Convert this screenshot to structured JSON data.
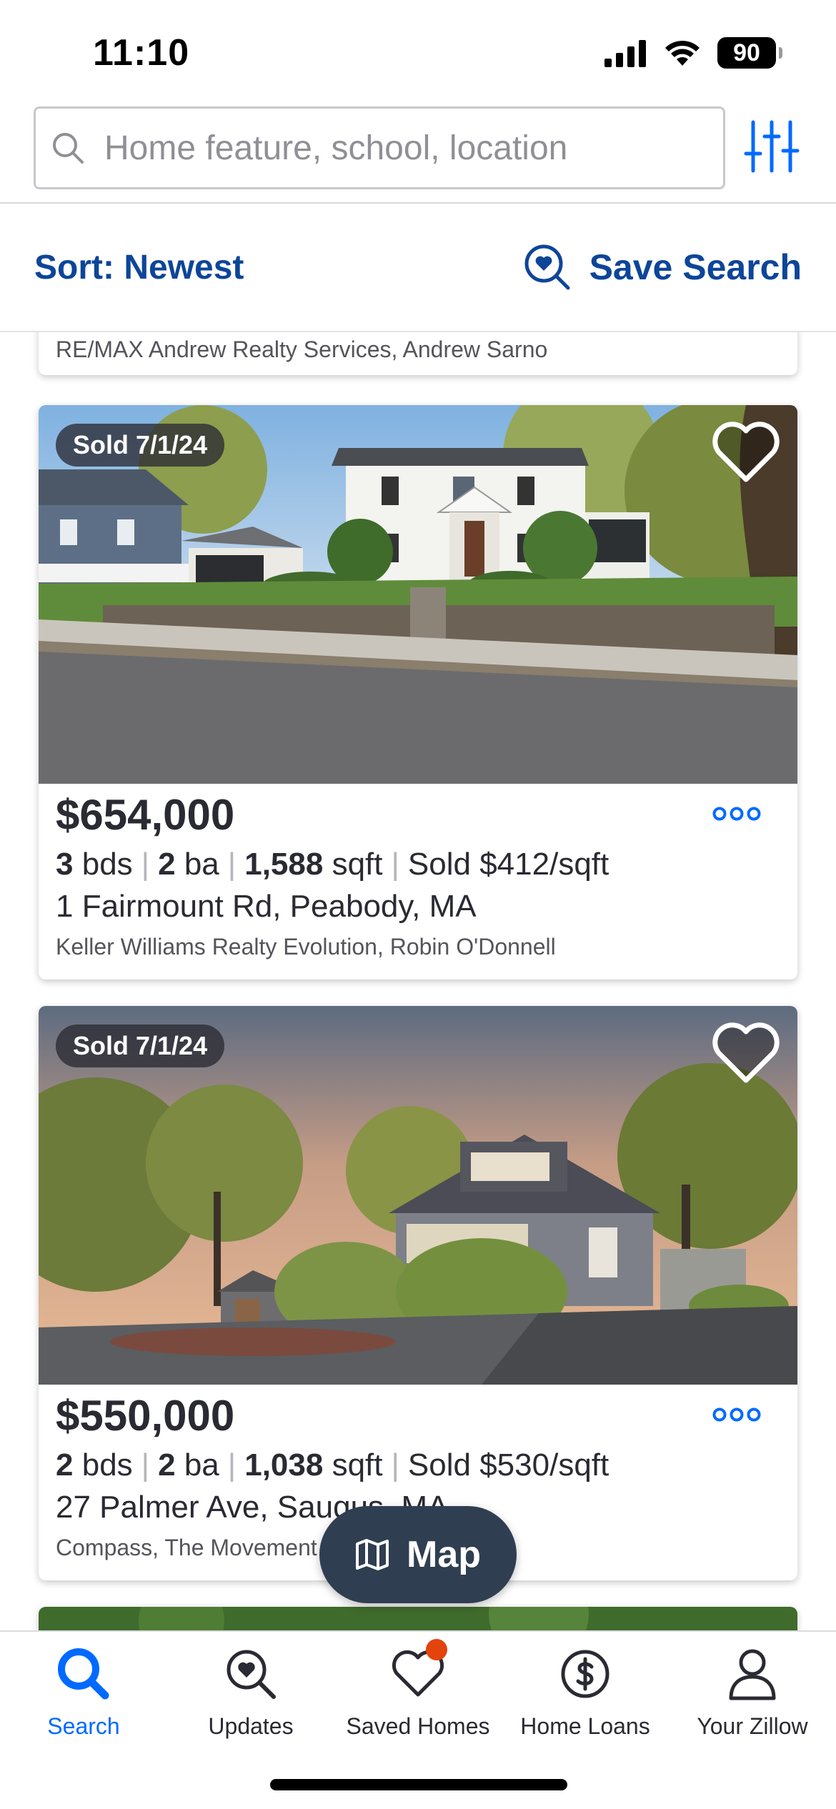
{
  "status_bar": {
    "time": "11:10",
    "battery": "90"
  },
  "search": {
    "placeholder": "Home feature, school, location",
    "value": ""
  },
  "sort": {
    "label": "Sort: Newest",
    "save_search_label": "Save Search"
  },
  "listings": [
    {
      "broker": "RE/MAX Andrew Realty Services, Andrew Sarno"
    },
    {
      "badge": "Sold 7/1/24",
      "price": "$654,000",
      "beds": "3",
      "beds_unit": "bds",
      "baths": "2",
      "baths_unit": "ba",
      "sqft": "1,588",
      "sqft_unit": "sqft",
      "price_per_sqft": "Sold $412/sqft",
      "address": "1 Fairmount Rd, Peabody, MA",
      "broker": "Keller Williams Realty Evolution, Robin O'Donnell"
    },
    {
      "badge": "Sold 7/1/24",
      "price": "$550,000",
      "beds": "2",
      "beds_unit": "bds",
      "baths": "2",
      "baths_unit": "ba",
      "sqft": "1,038",
      "sqft_unit": "sqft",
      "price_per_sqft": "Sold $530/sqft",
      "address": "27 Palmer Ave, Saugus, MA",
      "broker": "Compass, The Movement Group"
    }
  ],
  "map_button": {
    "label": "Map"
  },
  "bottom_nav": [
    {
      "label": "Search",
      "icon": "search-icon",
      "active": true
    },
    {
      "label": "Updates",
      "icon": "updates-icon",
      "active": false
    },
    {
      "label": "Saved Homes",
      "icon": "heart-icon",
      "active": false
    },
    {
      "label": "Home Loans",
      "icon": "dollar-icon",
      "active": false
    },
    {
      "label": "Your Zillow",
      "icon": "person-icon",
      "active": false
    }
  ],
  "colors": {
    "brand_blue": "#006aff",
    "link_blue": "#0d4599",
    "map_button": "#2f3e51",
    "notification_dot": "#e3430d"
  }
}
